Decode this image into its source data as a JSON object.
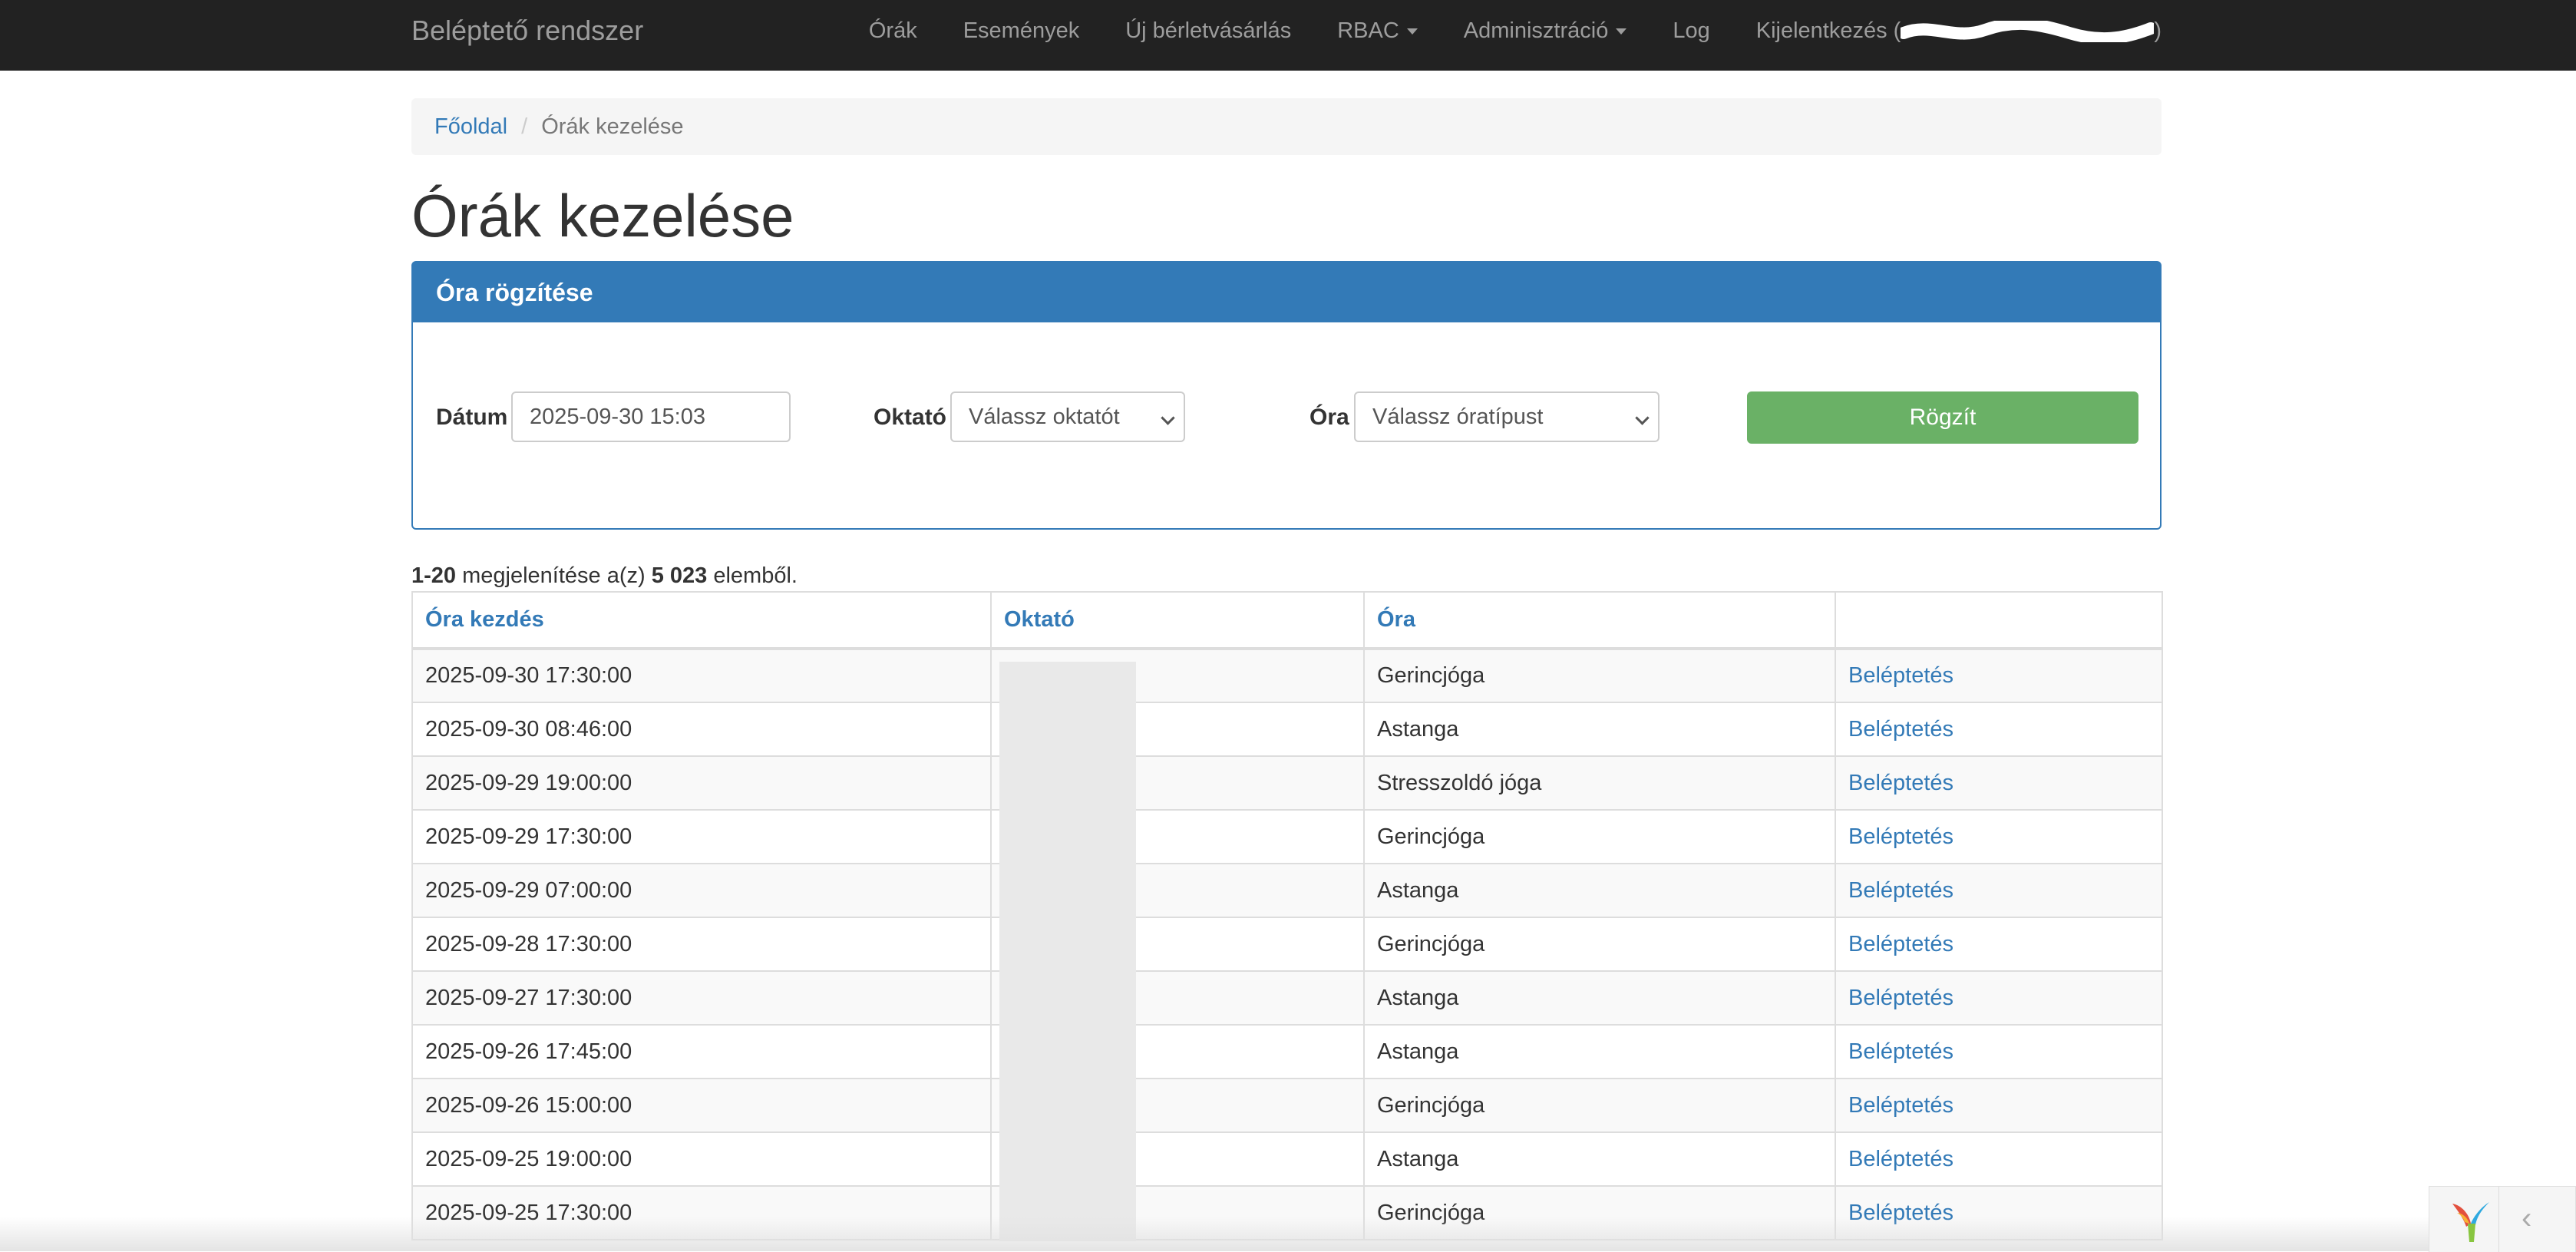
{
  "navbar": {
    "brand": "Beléptető rendszer",
    "items": [
      {
        "label": "Órák"
      },
      {
        "label": "Események"
      },
      {
        "label": "Új bérletvásárlás"
      },
      {
        "label": "RBAC"
      },
      {
        "label": "Adminisztráció"
      },
      {
        "label": "Log"
      },
      {
        "label": "Kijelentkezés (",
        "suffix": ")"
      }
    ]
  },
  "breadcrumb": {
    "home": "Főoldal",
    "separator": "/",
    "current": "Órák kezelése"
  },
  "page_title": "Órák kezelése",
  "panel": {
    "heading": "Óra rögzítése",
    "date_label": "Dátum",
    "date_value": "2025-09-30 15:03",
    "instructor_label": "Oktató",
    "instructor_selected": "Válassz oktatót",
    "class_label": "Óra",
    "class_selected": "Válassz óratípust",
    "submit_label": "Rögzít"
  },
  "summary": {
    "range": "1-20",
    "middle": " megjelenítése a(z) ",
    "total": "5 023",
    "suffix": " elemből."
  },
  "table": {
    "headers": [
      "Óra kezdés",
      "Oktató",
      "Óra",
      ""
    ],
    "rows": [
      {
        "start": "2025-09-30 17:30:00",
        "class": "Gerincjóga",
        "action": "Beléptetés"
      },
      {
        "start": "2025-09-30 08:46:00",
        "class": "Astanga",
        "action": "Beléptetés"
      },
      {
        "start": "2025-09-29 19:00:00",
        "class": "Stresszoldó jóga",
        "action": "Beléptetés"
      },
      {
        "start": "2025-09-29 17:30:00",
        "class": "Gerincjóga",
        "action": "Beléptetés"
      },
      {
        "start": "2025-09-29 07:00:00",
        "class": "Astanga",
        "action": "Beléptetés"
      },
      {
        "start": "2025-09-28 17:30:00",
        "class": "Gerincjóga",
        "action": "Beléptetés"
      },
      {
        "start": "2025-09-27 17:30:00",
        "class": "Astanga",
        "action": "Beléptetés"
      },
      {
        "start": "2025-09-26 17:45:00",
        "class": "Astanga",
        "action": "Beléptetés"
      },
      {
        "start": "2025-09-26 15:00:00",
        "class": "Gerincjóga",
        "action": "Beléptetés"
      },
      {
        "start": "2025-09-25 19:00:00",
        "class": "Astanga",
        "action": "Beléptetés"
      },
      {
        "start": "2025-09-25 17:30:00",
        "class": "Gerincjóga",
        "action": "Beléptetés"
      }
    ]
  },
  "debug_toolbar": {
    "logo_icon": "yii-logo-icon",
    "toggle_icon": "chevron-left-icon",
    "toggle_glyph": "‹"
  },
  "colors": {
    "navbar_bg": "#222222",
    "primary": "#337ab7",
    "success": "#6ab166"
  }
}
